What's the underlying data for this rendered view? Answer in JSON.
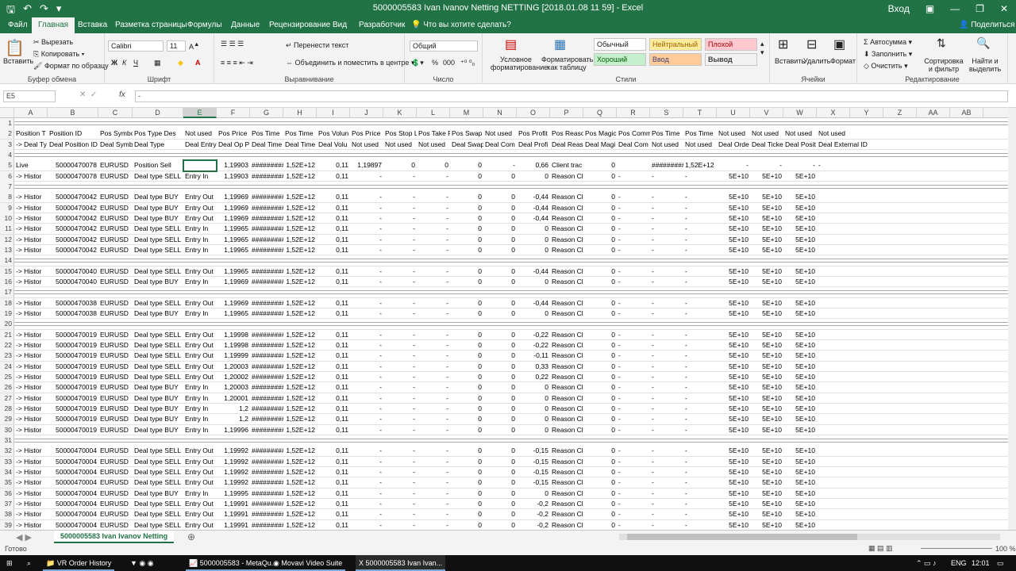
{
  "window": {
    "title": "5000005583 Ivan Ivanov Netting NETTING [2018.01.08 11 59]  -  Excel",
    "signin": "Вход"
  },
  "tabs": [
    "Файл",
    "Главная",
    "Вставка",
    "Разметка страницы",
    "Формулы",
    "Данные",
    "Рецензирование",
    "Вид",
    "Разработчик"
  ],
  "tell_me": "Что вы хотите сделать?",
  "share": "Поделиться",
  "ribbon": {
    "paste": "Вставить",
    "cut": "Вырезать",
    "copy": "Копировать",
    "format_painter": "Формат по образцу",
    "clipboard": "Буфер обмена",
    "font_name": "Calibri",
    "font_size": "11",
    "bold": "Ж",
    "italic": "К",
    "underline": "Ч",
    "font": "Шрифт",
    "wrap": "Перенести текст",
    "merge": "Объединить и поместить в центре",
    "alignment": "Выравнивание",
    "numfmt": "Общий",
    "number": "Число",
    "pct": "%",
    "thousands": "000",
    "cond_format": "Условное форматирование",
    "format_table": "Форматировать как таблицу",
    "styles": {
      "normal": "Обычный",
      "neutral": "Нейтральный",
      "bad": "Плохой",
      "good": "Хороший",
      "input": "Ввод",
      "output": "Вывод"
    },
    "styles_label": "Стили",
    "insert": "Вставить",
    "delete": "Удалить",
    "format": "Формат",
    "cells": "Ячейки",
    "autosum": "Автосумма",
    "fill": "Заполнить",
    "clear": "Очистить",
    "sort": "Сортировка и фильтр",
    "find": "Найти и выделить",
    "editing": "Редактирование"
  },
  "formula": {
    "namebox": "E5",
    "fx": "fx",
    "value": "-"
  },
  "columns": [
    "A",
    "B",
    "C",
    "D",
    "E",
    "F",
    "G",
    "H",
    "I",
    "J",
    "K",
    "L",
    "M",
    "N",
    "O",
    "P",
    "Q",
    "R",
    "S",
    "T",
    "U",
    "V",
    "W",
    "X",
    "Y",
    "Z",
    "AA",
    "AB"
  ],
  "rows": [
    {
      "n": "1",
      "sep": true
    },
    {
      "n": "2",
      "cells": [
        "Position T",
        "Position ID",
        "Pos Symbo",
        "Pos Type Des",
        "Not used",
        "Pos Price",
        "Pos Time",
        "Pos Time",
        "Pos Volun",
        "Pos Price",
        "Pos Stop L",
        "Pos Take P",
        "Pos Swap",
        "Not used",
        "Pos Profit",
        "Pos Reaso",
        "Pos Magic",
        "Pos Comm",
        "Pos Time",
        "Pos Time",
        "Not used",
        "Not used",
        "Not used",
        "Not used",
        "",
        "",
        "",
        ""
      ]
    },
    {
      "n": "3",
      "cells": [
        "-> Deal Ty",
        "Deal Position ID",
        "Deal Symb",
        "Deal Type",
        "Deal Entry",
        "Deal Op P",
        "Deal Time",
        "Deal Time",
        "Deal Volu",
        "Not used",
        "Not used",
        "Not used",
        "Deal Swap",
        "Deal Com",
        "Deal Profi",
        "Deal Reas",
        "Deal Magi",
        "Deal Com",
        "Not used",
        "Not used",
        "Deal Orde",
        "Deal Ticke",
        "Deal Posit",
        "Deal External ID",
        "",
        "",
        "",
        ""
      ]
    },
    {
      "n": "4",
      "sep": true
    },
    {
      "n": "5",
      "cells": [
        "Live",
        "50000470078",
        "EURUSD",
        "Position Sell",
        "",
        "1,19903",
        "#########",
        "1,52E+12",
        "0,11",
        "1,19897",
        "0",
        "0",
        "0",
        "-",
        "0,66",
        "Client trac",
        "0",
        "",
        "#########",
        "1,52E+12",
        "-",
        "-",
        "-",
        "-",
        "",
        "",
        "",
        ""
      ]
    },
    {
      "n": "6",
      "cells": [
        "-> Histor",
        "50000470078",
        "EURUSD",
        "Deal type SELL",
        "Entry In",
        "1,19903",
        "#########",
        "1,52E+12",
        "0,11",
        "-",
        "-",
        "-",
        "0",
        "0",
        "0",
        "Reason Cl",
        "0",
        "-",
        "-",
        "-",
        "5E+10",
        "5E+10",
        "5E+10",
        "",
        "",
        "",
        "",
        ""
      ]
    },
    {
      "n": "7",
      "sep": true
    },
    {
      "n": "8",
      "cells": [
        "-> Histor",
        "50000470042",
        "EURUSD",
        "Deal type BUY",
        "Entry Out",
        "1,19969",
        "#########",
        "1,52E+12",
        "0,11",
        "-",
        "-",
        "-",
        "0",
        "0",
        "-0,44",
        "Reason Cl",
        "0",
        "-",
        "-",
        "-",
        "5E+10",
        "5E+10",
        "5E+10",
        "",
        "",
        "",
        "",
        ""
      ]
    },
    {
      "n": "9",
      "cells": [
        "-> Histor",
        "50000470042",
        "EURUSD",
        "Deal type BUY",
        "Entry Out",
        "1,19969",
        "#########",
        "1,52E+12",
        "0,11",
        "-",
        "-",
        "-",
        "0",
        "0",
        "-0,44",
        "Reason Cl",
        "0",
        "-",
        "-",
        "-",
        "5E+10",
        "5E+10",
        "5E+10",
        "",
        "",
        "",
        "",
        ""
      ]
    },
    {
      "n": "10",
      "cells": [
        "-> Histor",
        "50000470042",
        "EURUSD",
        "Deal type BUY",
        "Entry Out",
        "1,19969",
        "#########",
        "1,52E+12",
        "0,11",
        "-",
        "-",
        "-",
        "0",
        "0",
        "-0,44",
        "Reason Cl",
        "0",
        "-",
        "-",
        "-",
        "5E+10",
        "5E+10",
        "5E+10",
        "",
        "",
        "",
        "",
        ""
      ]
    },
    {
      "n": "11",
      "cells": [
        "-> Histor",
        "50000470042",
        "EURUSD",
        "Deal type SELL",
        "Entry In",
        "1,19965",
        "#########",
        "1,52E+12",
        "0,11",
        "-",
        "-",
        "-",
        "0",
        "0",
        "0",
        "Reason Cl",
        "0",
        "-",
        "-",
        "-",
        "5E+10",
        "5E+10",
        "5E+10",
        "",
        "",
        "",
        "",
        ""
      ]
    },
    {
      "n": "12",
      "cells": [
        "-> Histor",
        "50000470042",
        "EURUSD",
        "Deal type SELL",
        "Entry In",
        "1,19965",
        "#########",
        "1,52E+12",
        "0,11",
        "-",
        "-",
        "-",
        "0",
        "0",
        "0",
        "Reason Cl",
        "0",
        "-",
        "-",
        "-",
        "5E+10",
        "5E+10",
        "5E+10",
        "",
        "",
        "",
        "",
        ""
      ]
    },
    {
      "n": "13",
      "cells": [
        "-> Histor",
        "50000470042",
        "EURUSD",
        "Deal type SELL",
        "Entry In",
        "1,19965",
        "#########",
        "1,52E+12",
        "0,11",
        "-",
        "-",
        "-",
        "0",
        "0",
        "0",
        "Reason Cl",
        "0",
        "-",
        "-",
        "-",
        "5E+10",
        "5E+10",
        "5E+10",
        "",
        "",
        "",
        "",
        ""
      ]
    },
    {
      "n": "14",
      "sep": true
    },
    {
      "n": "15",
      "cells": [
        "-> Histor",
        "50000470040",
        "EURUSD",
        "Deal type SELL",
        "Entry Out",
        "1,19965",
        "#########",
        "1,52E+12",
        "0,11",
        "-",
        "-",
        "-",
        "0",
        "0",
        "-0,44",
        "Reason Cl",
        "0",
        "-",
        "-",
        "-",
        "5E+10",
        "5E+10",
        "5E+10",
        "",
        "",
        "",
        "",
        ""
      ]
    },
    {
      "n": "16",
      "cells": [
        "-> Histor",
        "50000470040",
        "EURUSD",
        "Deal type BUY",
        "Entry In",
        "1,19969",
        "#########",
        "1,52E+12",
        "0,11",
        "-",
        "-",
        "-",
        "0",
        "0",
        "0",
        "Reason Cl",
        "0",
        "-",
        "-",
        "-",
        "5E+10",
        "5E+10",
        "5E+10",
        "",
        "",
        "",
        "",
        ""
      ]
    },
    {
      "n": "17",
      "sep": true
    },
    {
      "n": "18",
      "cells": [
        "-> Histor",
        "50000470038",
        "EURUSD",
        "Deal type SELL",
        "Entry Out",
        "1,19969",
        "#########",
        "1,52E+12",
        "0,11",
        "-",
        "-",
        "-",
        "0",
        "0",
        "-0,44",
        "Reason Cl",
        "0",
        "-",
        "-",
        "-",
        "5E+10",
        "5E+10",
        "5E+10",
        "",
        "",
        "",
        "",
        ""
      ]
    },
    {
      "n": "19",
      "cells": [
        "-> Histor",
        "50000470038",
        "EURUSD",
        "Deal type BUY",
        "Entry In",
        "1,19965",
        "#########",
        "1,52E+12",
        "0,11",
        "-",
        "-",
        "-",
        "0",
        "0",
        "0",
        "Reason Cl",
        "0",
        "-",
        "-",
        "-",
        "5E+10",
        "5E+10",
        "5E+10",
        "",
        "",
        "",
        "",
        ""
      ]
    },
    {
      "n": "20",
      "sep": true
    },
    {
      "n": "21",
      "cells": [
        "-> Histor",
        "50000470019",
        "EURUSD",
        "Deal type SELL",
        "Entry Out",
        "1,19998",
        "#########",
        "1,52E+12",
        "0,11",
        "-",
        "-",
        "-",
        "0",
        "0",
        "-0,22",
        "Reason Cl",
        "0",
        "-",
        "-",
        "-",
        "5E+10",
        "5E+10",
        "5E+10",
        "",
        "",
        "",
        "",
        ""
      ]
    },
    {
      "n": "22",
      "cells": [
        "-> Histor",
        "50000470019",
        "EURUSD",
        "Deal type SELL",
        "Entry Out",
        "1,19998",
        "#########",
        "1,52E+12",
        "0,11",
        "-",
        "-",
        "-",
        "0",
        "0",
        "-0,22",
        "Reason Cl",
        "0",
        "-",
        "-",
        "-",
        "5E+10",
        "5E+10",
        "5E+10",
        "",
        "",
        "",
        "",
        ""
      ]
    },
    {
      "n": "23",
      "cells": [
        "-> Histor",
        "50000470019",
        "EURUSD",
        "Deal type SELL",
        "Entry Out",
        "1,19999",
        "#########",
        "1,52E+12",
        "0,11",
        "-",
        "-",
        "-",
        "0",
        "0",
        "-0,11",
        "Reason Cl",
        "0",
        "-",
        "-",
        "-",
        "5E+10",
        "5E+10",
        "5E+10",
        "",
        "",
        "",
        "",
        ""
      ]
    },
    {
      "n": "24",
      "cells": [
        "-> Histor",
        "50000470019",
        "EURUSD",
        "Deal type SELL",
        "Entry Out",
        "1,20003",
        "#########",
        "1,52E+12",
        "0,11",
        "-",
        "-",
        "-",
        "0",
        "0",
        "0,33",
        "Reason Cl",
        "0",
        "-",
        "-",
        "-",
        "5E+10",
        "5E+10",
        "5E+10",
        "",
        "",
        "",
        "",
        ""
      ]
    },
    {
      "n": "25",
      "cells": [
        "-> Histor",
        "50000470019",
        "EURUSD",
        "Deal type SELL",
        "Entry Out",
        "1,20002",
        "#########",
        "1,52E+12",
        "0,11",
        "-",
        "-",
        "-",
        "0",
        "0",
        "0,22",
        "Reason Cl",
        "0",
        "-",
        "-",
        "-",
        "5E+10",
        "5E+10",
        "5E+10",
        "",
        "",
        "",
        "",
        ""
      ]
    },
    {
      "n": "26",
      "cells": [
        "-> Histor",
        "50000470019",
        "EURUSD",
        "Deal type BUY",
        "Entry In",
        "1,20003",
        "#########",
        "1,52E+12",
        "0,11",
        "-",
        "-",
        "-",
        "0",
        "0",
        "0",
        "Reason Cl",
        "0",
        "-",
        "-",
        "-",
        "5E+10",
        "5E+10",
        "5E+10",
        "",
        "",
        "",
        "",
        ""
      ]
    },
    {
      "n": "27",
      "cells": [
        "-> Histor",
        "50000470019",
        "EURUSD",
        "Deal type BUY",
        "Entry In",
        "1,20001",
        "#########",
        "1,52E+12",
        "0,11",
        "-",
        "-",
        "-",
        "0",
        "0",
        "0",
        "Reason Cl",
        "0",
        "-",
        "-",
        "-",
        "5E+10",
        "5E+10",
        "5E+10",
        "",
        "",
        "",
        "",
        ""
      ]
    },
    {
      "n": "28",
      "cells": [
        "-> Histor",
        "50000470019",
        "EURUSD",
        "Deal type BUY",
        "Entry In",
        "1,2",
        "#########",
        "1,52E+12",
        "0,11",
        "-",
        "-",
        "-",
        "0",
        "0",
        "0",
        "Reason Cl",
        "0",
        "-",
        "-",
        "-",
        "5E+10",
        "5E+10",
        "5E+10",
        "",
        "",
        "",
        "",
        ""
      ]
    },
    {
      "n": "29",
      "cells": [
        "-> Histor",
        "50000470019",
        "EURUSD",
        "Deal type BUY",
        "Entry In",
        "1,2",
        "#########",
        "1,52E+12",
        "0,11",
        "-",
        "-",
        "-",
        "0",
        "0",
        "0",
        "Reason Cl",
        "0",
        "-",
        "-",
        "-",
        "5E+10",
        "5E+10",
        "5E+10",
        "",
        "",
        "",
        "",
        ""
      ]
    },
    {
      "n": "30",
      "cells": [
        "-> Histor",
        "50000470019",
        "EURUSD",
        "Deal type BUY",
        "Entry In",
        "1,19996",
        "#########",
        "1,52E+12",
        "0,11",
        "-",
        "-",
        "-",
        "0",
        "0",
        "0",
        "Reason Cl",
        "0",
        "-",
        "-",
        "-",
        "5E+10",
        "5E+10",
        "5E+10",
        "",
        "",
        "",
        "",
        ""
      ]
    },
    {
      "n": "31",
      "sep": true
    },
    {
      "n": "32",
      "cells": [
        "-> Histor",
        "50000470004",
        "EURUSD",
        "Deal type SELL",
        "Entry Out",
        "1,19992",
        "#########",
        "1,52E+12",
        "0,11",
        "-",
        "-",
        "-",
        "0",
        "0",
        "-0,15",
        "Reason Cl",
        "0",
        "-",
        "-",
        "-",
        "5E+10",
        "5E+10",
        "5E+10",
        "",
        "",
        "",
        "",
        ""
      ]
    },
    {
      "n": "33",
      "cells": [
        "-> Histor",
        "50000470004",
        "EURUSD",
        "Deal type SELL",
        "Entry Out",
        "1,19992",
        "#########",
        "1,52E+12",
        "0,11",
        "-",
        "-",
        "-",
        "0",
        "0",
        "-0,15",
        "Reason Cl",
        "0",
        "-",
        "-",
        "-",
        "5E+10",
        "5E+10",
        "5E+10",
        "",
        "",
        "",
        "",
        ""
      ]
    },
    {
      "n": "34",
      "cells": [
        "-> Histor",
        "50000470004",
        "EURUSD",
        "Deal type SELL",
        "Entry Out",
        "1,19992",
        "#########",
        "1,52E+12",
        "0,11",
        "-",
        "-",
        "-",
        "0",
        "0",
        "-0,15",
        "Reason Cl",
        "0",
        "-",
        "-",
        "-",
        "5E+10",
        "5E+10",
        "5E+10",
        "",
        "",
        "",
        "",
        ""
      ]
    },
    {
      "n": "35",
      "cells": [
        "-> Histor",
        "50000470004",
        "EURUSD",
        "Deal type SELL",
        "Entry Out",
        "1,19992",
        "#########",
        "1,52E+12",
        "0,11",
        "-",
        "-",
        "-",
        "0",
        "0",
        "-0,15",
        "Reason Cl",
        "0",
        "-",
        "-",
        "-",
        "5E+10",
        "5E+10",
        "5E+10",
        "",
        "",
        "",
        "",
        ""
      ]
    },
    {
      "n": "36",
      "cells": [
        "-> Histor",
        "50000470004",
        "EURUSD",
        "Deal type BUY",
        "Entry In",
        "1,19995",
        "#########",
        "1,52E+12",
        "0,11",
        "-",
        "-",
        "-",
        "0",
        "0",
        "0",
        "Reason Cl",
        "0",
        "-",
        "-",
        "-",
        "5E+10",
        "5E+10",
        "5E+10",
        "",
        "",
        "",
        "",
        ""
      ]
    },
    {
      "n": "37",
      "cells": [
        "-> Histor",
        "50000470004",
        "EURUSD",
        "Deal type SELL",
        "Entry Out",
        "1,19991",
        "#########",
        "1,52E+12",
        "0,11",
        "-",
        "-",
        "-",
        "0",
        "0",
        "-0,2",
        "Reason Cl",
        "0",
        "-",
        "-",
        "-",
        "5E+10",
        "5E+10",
        "5E+10",
        "",
        "",
        "",
        "",
        ""
      ]
    },
    {
      "n": "38",
      "cells": [
        "-> Histor",
        "50000470004",
        "EURUSD",
        "Deal type SELL",
        "Entry Out",
        "1,19991",
        "#########",
        "1,52E+12",
        "0,11",
        "-",
        "-",
        "-",
        "0",
        "0",
        "-0,2",
        "Reason Cl",
        "0",
        "-",
        "-",
        "-",
        "5E+10",
        "5E+10",
        "5E+10",
        "",
        "",
        "",
        "",
        ""
      ]
    },
    {
      "n": "39",
      "cells": [
        "-> Histor",
        "50000470004",
        "EURUSD",
        "Deal type SELL",
        "Entry Out",
        "1,19991",
        "#########",
        "1,52E+12",
        "0,11",
        "-",
        "-",
        "-",
        "0",
        "0",
        "-0,2",
        "Reason Cl",
        "0",
        "-",
        "-",
        "-",
        "5E+10",
        "5E+10",
        "5E+10",
        "",
        "",
        "",
        "",
        ""
      ]
    }
  ],
  "sheet_tab": "5000005583 Ivan Ivanov Netting",
  "status": {
    "ready": "Готово",
    "zoom": "100 %"
  },
  "taskbar": {
    "apps": [
      "VR Order History",
      "5000005583 - MetaQu...",
      "Movavi Video Suite",
      "5000005583 Ivan Ivan..."
    ],
    "lang": "ENG",
    "time": "12:01"
  }
}
